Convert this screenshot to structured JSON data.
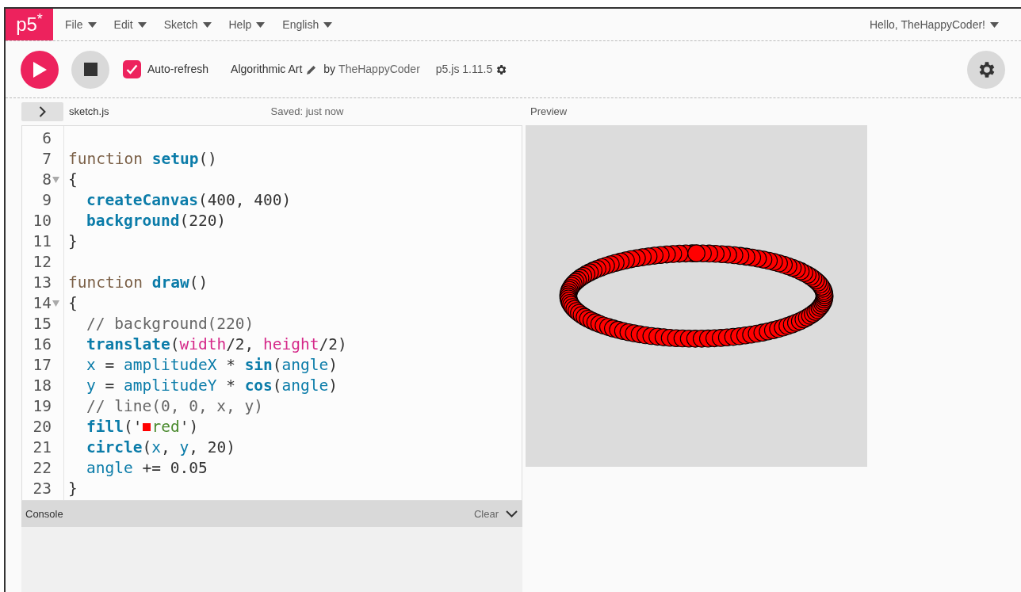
{
  "menubar": {
    "logo": "p5$^{*}$",
    "menus": [
      {
        "label": "File"
      },
      {
        "label": "Edit"
      },
      {
        "label": "Sketch"
      },
      {
        "label": "Help"
      },
      {
        "label": "English"
      }
    ],
    "user": "Hello, TheHappyCoder!"
  },
  "toolbar": {
    "auto_refresh": {
      "label": "Auto-refresh",
      "checked": true
    },
    "sketch_name": "Algorithmic Art",
    "by": "by",
    "author": "TheHappyCoder",
    "version": "p5.js 1.11.5"
  },
  "editor": {
    "file": "sketch.js",
    "status": "Saved: just now",
    "lines": [
      {
        "number": "6",
        "fold": false,
        "indented": false
      },
      {
        "number": "7",
        "fold": false,
        "indented": false,
        "tokens": [
          {
            "kind": "keyword",
            "text": "function "
          },
          {
            "kind": "def",
            "text": "setup"
          },
          {
            "kind": "plain",
            "text": "()"
          }
        ]
      },
      {
        "number": "8",
        "fold": true,
        "indented": false,
        "tokens": [
          {
            "kind": "plain",
            "text": "{"
          }
        ]
      },
      {
        "number": "9",
        "fold": false,
        "indented": true,
        "tokens": [
          {
            "kind": "fn",
            "text": "createCanvas"
          },
          {
            "kind": "plain",
            "text": "(400, 400)"
          }
        ]
      },
      {
        "number": "10",
        "fold": false,
        "indented": true,
        "tokens": [
          {
            "kind": "fn",
            "text": "background"
          },
          {
            "kind": "plain",
            "text": "(220)"
          }
        ]
      },
      {
        "number": "11",
        "fold": false,
        "indented": false,
        "tokens": [
          {
            "kind": "plain",
            "text": "}"
          }
        ]
      },
      {
        "number": "12",
        "fold": false,
        "indented": false
      },
      {
        "number": "13",
        "fold": false,
        "indented": false,
        "tokens": [
          {
            "kind": "keyword",
            "text": "function "
          },
          {
            "kind": "def",
            "text": "draw"
          },
          {
            "kind": "plain",
            "text": "()"
          }
        ]
      },
      {
        "number": "14",
        "fold": true,
        "indented": false,
        "tokens": [
          {
            "kind": "plain",
            "text": "{"
          }
        ]
      },
      {
        "number": "15",
        "fold": false,
        "indented": true,
        "tokens": [
          {
            "kind": "comment",
            "text": "// background(220)"
          }
        ]
      },
      {
        "number": "16",
        "fold": false,
        "indented": true,
        "tokens": [
          {
            "kind": "fn",
            "text": "translate"
          },
          {
            "kind": "plain",
            "text": "("
          },
          {
            "kind": "prop",
            "text": "width"
          },
          {
            "kind": "plain",
            "text": "/2, "
          },
          {
            "kind": "prop",
            "text": "height"
          },
          {
            "kind": "plain",
            "text": "/2)"
          }
        ]
      },
      {
        "number": "17",
        "fold": false,
        "indented": true,
        "tokens": [
          {
            "kind": "var",
            "text": "x"
          },
          {
            "kind": "plain",
            "text": " = "
          },
          {
            "kind": "var",
            "text": "amplitudeX"
          },
          {
            "kind": "plain",
            "text": " * "
          },
          {
            "kind": "fn",
            "text": "sin"
          },
          {
            "kind": "plain",
            "text": "("
          },
          {
            "kind": "var",
            "text": "angle"
          },
          {
            "kind": "plain",
            "text": ")"
          }
        ]
      },
      {
        "number": "18",
        "fold": false,
        "indented": true,
        "tokens": [
          {
            "kind": "var",
            "text": "y"
          },
          {
            "kind": "plain",
            "text": " = "
          },
          {
            "kind": "var",
            "text": "amplitudeY"
          },
          {
            "kind": "plain",
            "text": " * "
          },
          {
            "kind": "fn",
            "text": "cos"
          },
          {
            "kind": "plain",
            "text": "("
          },
          {
            "kind": "var",
            "text": "angle"
          },
          {
            "kind": "plain",
            "text": ")"
          }
        ]
      },
      {
        "number": "19",
        "fold": false,
        "indented": true,
        "tokens": [
          {
            "kind": "comment",
            "text": "// line(0, 0, x, y)"
          }
        ]
      },
      {
        "number": "20",
        "fold": false,
        "indented": true,
        "tokens": [
          {
            "kind": "fn",
            "text": "fill"
          },
          {
            "kind": "plain",
            "text": "('"
          },
          {
            "kind": "swatch",
            "color": "#ff0000"
          },
          {
            "kind": "string",
            "text": "red"
          },
          {
            "kind": "plain",
            "text": "')"
          }
        ]
      },
      {
        "number": "21",
        "fold": false,
        "indented": true,
        "tokens": [
          {
            "kind": "fn",
            "text": "circle"
          },
          {
            "kind": "plain",
            "text": "("
          },
          {
            "kind": "var",
            "text": "x"
          },
          {
            "kind": "plain",
            "text": ", "
          },
          {
            "kind": "var",
            "text": "y"
          },
          {
            "kind": "plain",
            "text": ", 20)"
          }
        ]
      },
      {
        "number": "22",
        "fold": false,
        "indented": true,
        "tokens": [
          {
            "kind": "var",
            "text": "angle"
          },
          {
            "kind": "plain",
            "text": " += 0.05"
          }
        ]
      },
      {
        "number": "23",
        "fold": false,
        "indented": false,
        "tokens": [
          {
            "kind": "plain",
            "text": "}"
          }
        ]
      }
    ]
  },
  "console": {
    "title": "Console",
    "clear": "Clear"
  },
  "preview": {
    "title": "Preview"
  }
}
